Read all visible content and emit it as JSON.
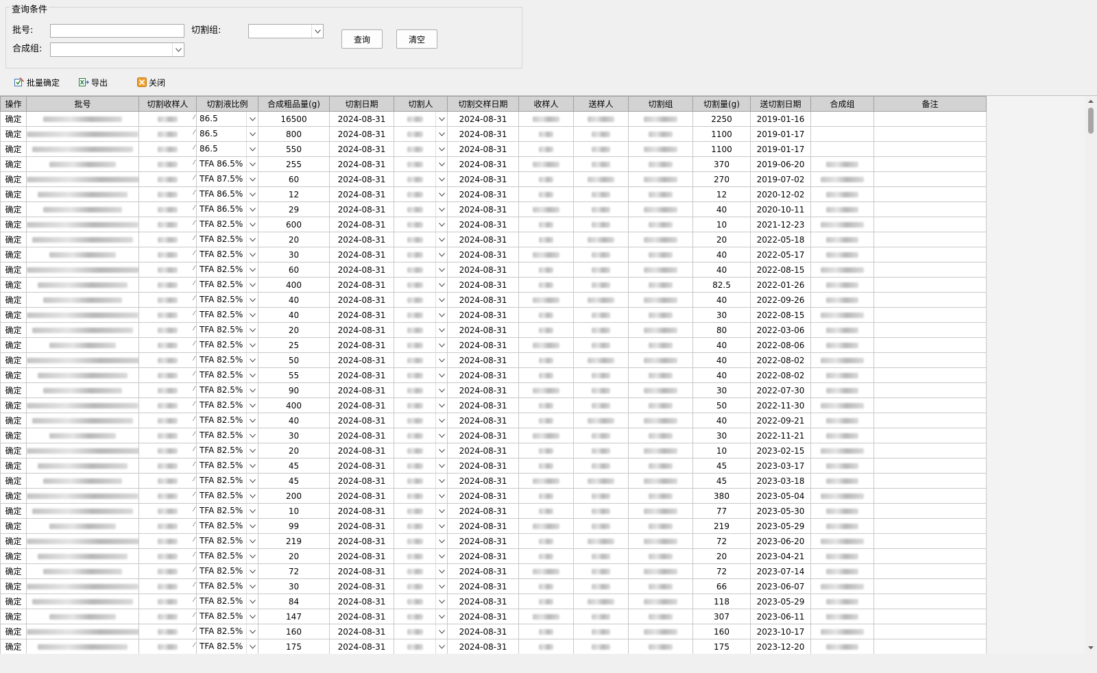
{
  "query_group": {
    "title": "查询条件",
    "batch_label": "批号:",
    "batch_value": "",
    "cut_group_label": "切割组:",
    "cut_group_value": "",
    "synth_group_label": "合成组:",
    "synth_group_value": "",
    "query_button": "查询",
    "clear_button": "清空"
  },
  "toolbar": {
    "batch_confirm": "批量确定",
    "export": "导出",
    "close": "关闭"
  },
  "table": {
    "headers": [
      "操作",
      "批号",
      "切割收样人",
      "切割液比例",
      "合成粗品量(g)",
      "切割日期",
      "切割人",
      "切割交样日期",
      "收样人",
      "送样人",
      "切割组",
      "切割量(g)",
      "送切割日期",
      "合成组",
      "备注"
    ],
    "action_label": "确定",
    "rows": [
      {
        "ratio": "86.5",
        "crude": "16500",
        "cut_date": "2024-08-31",
        "handover": "2024-08-31",
        "cut_amount": "2250",
        "send_date": "2019-01-16"
      },
      {
        "ratio": "86.5",
        "crude": "800",
        "cut_date": "2024-08-31",
        "handover": "2024-08-31",
        "cut_amount": "1100",
        "send_date": "2019-01-17"
      },
      {
        "ratio": "86.5",
        "crude": "550",
        "cut_date": "2024-08-31",
        "handover": "2024-08-31",
        "cut_amount": "1100",
        "send_date": "2019-01-17"
      },
      {
        "ratio": "TFA 86.5%",
        "crude": "255",
        "cut_date": "2024-08-31",
        "handover": "2024-08-31",
        "cut_amount": "370",
        "send_date": "2019-06-20"
      },
      {
        "ratio": "TFA 87.5%",
        "crude": "60",
        "cut_date": "2024-08-31",
        "handover": "2024-08-31",
        "cut_amount": "270",
        "send_date": "2019-07-02"
      },
      {
        "ratio": "TFA 86.5%",
        "crude": "12",
        "cut_date": "2024-08-31",
        "handover": "2024-08-31",
        "cut_amount": "12",
        "send_date": "2020-12-02"
      },
      {
        "ratio": "TFA 86.5%",
        "crude": "29",
        "cut_date": "2024-08-31",
        "handover": "2024-08-31",
        "cut_amount": "40",
        "send_date": "2020-10-11"
      },
      {
        "ratio": "TFA 82.5%",
        "crude": "600",
        "cut_date": "2024-08-31",
        "handover": "2024-08-31",
        "cut_amount": "10",
        "send_date": "2021-12-23"
      },
      {
        "ratio": "TFA 82.5%",
        "crude": "20",
        "cut_date": "2024-08-31",
        "handover": "2024-08-31",
        "cut_amount": "20",
        "send_date": "2022-05-18"
      },
      {
        "ratio": "TFA 82.5%",
        "crude": "30",
        "cut_date": "2024-08-31",
        "handover": "2024-08-31",
        "cut_amount": "40",
        "send_date": "2022-05-17"
      },
      {
        "ratio": "TFA 82.5%",
        "crude": "60",
        "cut_date": "2024-08-31",
        "handover": "2024-08-31",
        "cut_amount": "40",
        "send_date": "2022-08-15"
      },
      {
        "ratio": "TFA 82.5%",
        "crude": "400",
        "cut_date": "2024-08-31",
        "handover": "2024-08-31",
        "cut_amount": "82.5",
        "send_date": "2022-01-26"
      },
      {
        "ratio": "TFA 82.5%",
        "crude": "40",
        "cut_date": "2024-08-31",
        "handover": "2024-08-31",
        "cut_amount": "40",
        "send_date": "2022-09-26"
      },
      {
        "ratio": "TFA 82.5%",
        "crude": "40",
        "cut_date": "2024-08-31",
        "handover": "2024-08-31",
        "cut_amount": "30",
        "send_date": "2022-08-15"
      },
      {
        "ratio": "TFA 82.5%",
        "crude": "20",
        "cut_date": "2024-08-31",
        "handover": "2024-08-31",
        "cut_amount": "80",
        "send_date": "2022-03-06"
      },
      {
        "ratio": "TFA 82.5%",
        "crude": "25",
        "cut_date": "2024-08-31",
        "handover": "2024-08-31",
        "cut_amount": "40",
        "send_date": "2022-08-06"
      },
      {
        "ratio": "TFA 82.5%",
        "crude": "50",
        "cut_date": "2024-08-31",
        "handover": "2024-08-31",
        "cut_amount": "40",
        "send_date": "2022-08-02"
      },
      {
        "ratio": "TFA 82.5%",
        "crude": "55",
        "cut_date": "2024-08-31",
        "handover": "2024-08-31",
        "cut_amount": "40",
        "send_date": "2022-08-02"
      },
      {
        "ratio": "TFA 82.5%",
        "crude": "90",
        "cut_date": "2024-08-31",
        "handover": "2024-08-31",
        "cut_amount": "30",
        "send_date": "2022-07-30"
      },
      {
        "ratio": "TFA 82.5%",
        "crude": "400",
        "cut_date": "2024-08-31",
        "handover": "2024-08-31",
        "cut_amount": "50",
        "send_date": "2022-11-30"
      },
      {
        "ratio": "TFA 82.5%",
        "crude": "40",
        "cut_date": "2024-08-31",
        "handover": "2024-08-31",
        "cut_amount": "40",
        "send_date": "2022-09-21"
      },
      {
        "ratio": "TFA 82.5%",
        "crude": "30",
        "cut_date": "2024-08-31",
        "handover": "2024-08-31",
        "cut_amount": "30",
        "send_date": "2022-11-21"
      },
      {
        "ratio": "TFA 82.5%",
        "crude": "20",
        "cut_date": "2024-08-31",
        "handover": "2024-08-31",
        "cut_amount": "10",
        "send_date": "2023-02-15"
      },
      {
        "ratio": "TFA 82.5%",
        "crude": "45",
        "cut_date": "2024-08-31",
        "handover": "2024-08-31",
        "cut_amount": "45",
        "send_date": "2023-03-17"
      },
      {
        "ratio": "TFA 82.5%",
        "crude": "45",
        "cut_date": "2024-08-31",
        "handover": "2024-08-31",
        "cut_amount": "45",
        "send_date": "2023-03-18"
      },
      {
        "ratio": "TFA 82.5%",
        "crude": "200",
        "cut_date": "2024-08-31",
        "handover": "2024-08-31",
        "cut_amount": "380",
        "send_date": "2023-05-04"
      },
      {
        "ratio": "TFA 82.5%",
        "crude": "10",
        "cut_date": "2024-08-31",
        "handover": "2024-08-31",
        "cut_amount": "77",
        "send_date": "2023-05-30"
      },
      {
        "ratio": "TFA 82.5%",
        "crude": "99",
        "cut_date": "2024-08-31",
        "handover": "2024-08-31",
        "cut_amount": "219",
        "send_date": "2023-05-29"
      },
      {
        "ratio": "TFA 82.5%",
        "crude": "219",
        "cut_date": "2024-08-31",
        "handover": "2024-08-31",
        "cut_amount": "72",
        "send_date": "2023-06-20"
      },
      {
        "ratio": "TFA 82.5%",
        "crude": "20",
        "cut_date": "2024-08-31",
        "handover": "2024-08-31",
        "cut_amount": "20",
        "send_date": "2023-04-21"
      },
      {
        "ratio": "TFA 82.5%",
        "crude": "72",
        "cut_date": "2024-08-31",
        "handover": "2024-08-31",
        "cut_amount": "72",
        "send_date": "2023-07-14"
      },
      {
        "ratio": "TFA 82.5%",
        "crude": "30",
        "cut_date": "2024-08-31",
        "handover": "2024-08-31",
        "cut_amount": "66",
        "send_date": "2023-06-07"
      },
      {
        "ratio": "TFA 82.5%",
        "crude": "84",
        "cut_date": "2024-08-31",
        "handover": "2024-08-31",
        "cut_amount": "118",
        "send_date": "2023-05-29"
      },
      {
        "ratio": "TFA 82.5%",
        "crude": "147",
        "cut_date": "2024-08-31",
        "handover": "2024-08-31",
        "cut_amount": "307",
        "send_date": "2023-06-11"
      },
      {
        "ratio": "TFA 82.5%",
        "crude": "160",
        "cut_date": "2024-08-31",
        "handover": "2024-08-31",
        "cut_amount": "160",
        "send_date": "2023-10-17"
      },
      {
        "ratio": "TFA 82.5%",
        "crude": "175",
        "cut_date": "2024-08-31",
        "handover": "2024-08-31",
        "cut_amount": "175",
        "send_date": "2023-12-20"
      }
    ]
  },
  "icons": {
    "batch_confirm": "edit-check-icon",
    "export": "export-excel-icon",
    "close": "close-x-icon",
    "dropdown": "chevron-down-icon"
  }
}
